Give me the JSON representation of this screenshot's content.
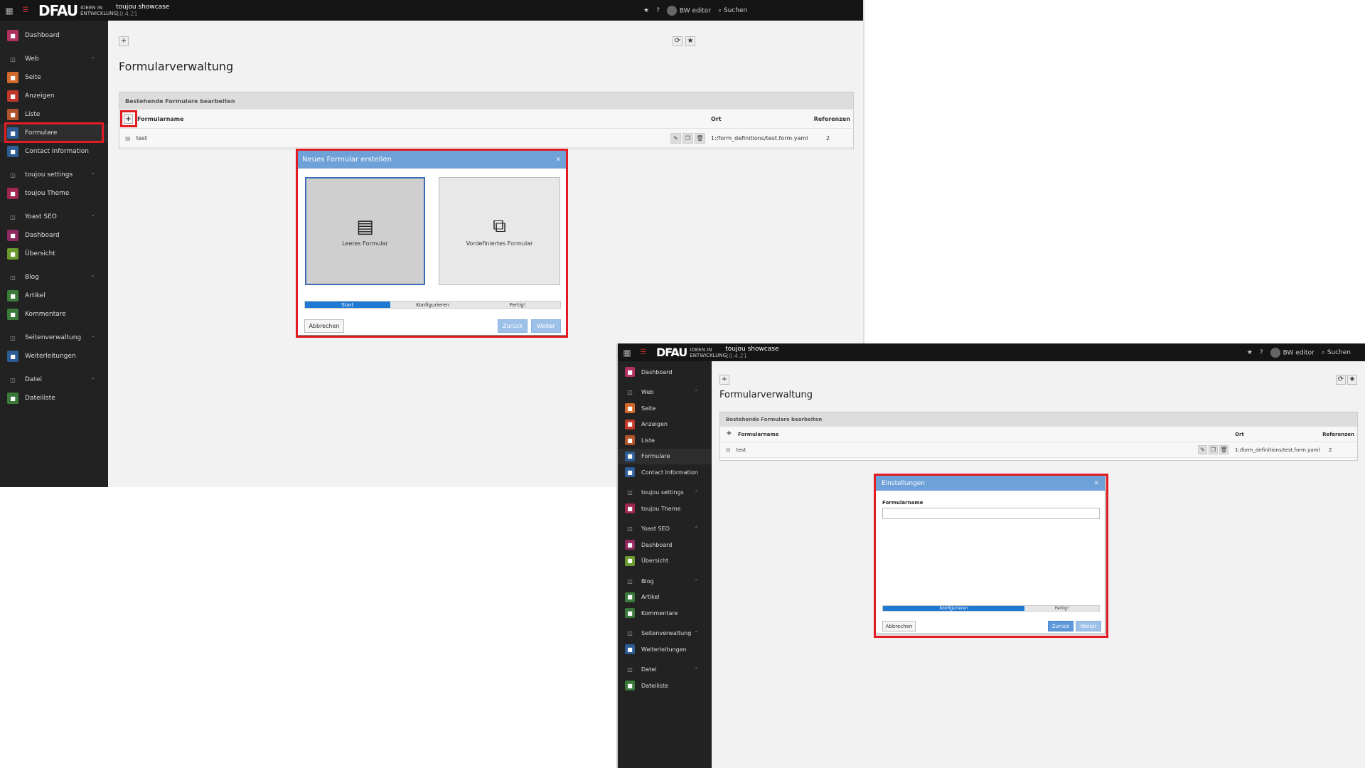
{
  "topbar": {
    "logo": "DFAU",
    "tagline": "IDEEN IN ENTWICKLUNG",
    "site_name": "toujou showcase",
    "version": "10.4.21",
    "user": "BW editor",
    "search_label": "Suchen"
  },
  "sidebar": {
    "items": [
      {
        "label": "Dashboard",
        "color": "#b03060",
        "group": false
      },
      {
        "label": "Web",
        "group": true
      },
      {
        "label": "Seite",
        "color": "#d0692a",
        "group": false
      },
      {
        "label": "Anzeigen",
        "color": "#c0392b",
        "group": false
      },
      {
        "label": "Liste",
        "color": "#b0522a",
        "group": false
      },
      {
        "label": "Formulare",
        "color": "#2d5d94",
        "group": false
      },
      {
        "label": "Contact Information",
        "color": "#2d5d94",
        "group": false
      },
      {
        "label": "toujou settings",
        "group": true
      },
      {
        "label": "toujou Theme",
        "color": "#a02850",
        "group": false
      },
      {
        "label": "Yoast SEO",
        "group": true
      },
      {
        "label": "Dashboard",
        "color": "#8e2a5f",
        "group": false
      },
      {
        "label": "Übersicht",
        "color": "#6a9a2e",
        "group": false
      },
      {
        "label": "Blog",
        "group": true
      },
      {
        "label": "Artikel",
        "color": "#3c7a3c",
        "group": false
      },
      {
        "label": "Kommentare",
        "color": "#3c7a3c",
        "group": false
      },
      {
        "label": "Seitenverwaltung",
        "group": true
      },
      {
        "label": "Weiterleitungen",
        "color": "#2d5d94",
        "group": false
      },
      {
        "label": "Datei",
        "group": true
      },
      {
        "label": "Dateiliste",
        "color": "#3c7a3c",
        "group": false
      }
    ]
  },
  "page": {
    "title": "Formularverwaltung",
    "panel_title": "Bestehende Formulare bearbeiten",
    "col_name": "Formularname",
    "col_location": "Ort",
    "col_refs": "Referenzen",
    "row_name": "test",
    "row_location": "1:/form_definitions/test.form.yaml",
    "row_refs": "2"
  },
  "modal1": {
    "title": "Neues Formular erstellen",
    "choice_blank": "Leeres Formular",
    "choice_predefined": "Vordefiniertes Formular",
    "steps": [
      "Start",
      "Konfigurieren",
      "Fertig!"
    ],
    "cancel": "Abbrechen",
    "back": "Zurück",
    "next": "Weiter"
  },
  "modal2": {
    "title": "Einstellungen",
    "field_label": "Formularname",
    "field_value": "",
    "steps": [
      "Konfigurieren",
      "Fertig!"
    ],
    "cancel": "Abbrechen",
    "back": "Zurück",
    "next": "Weiter"
  },
  "colors": {
    "highlight": "#e31b23",
    "modal_header": "#6ea1d8",
    "step_active": "#1f78d1"
  }
}
